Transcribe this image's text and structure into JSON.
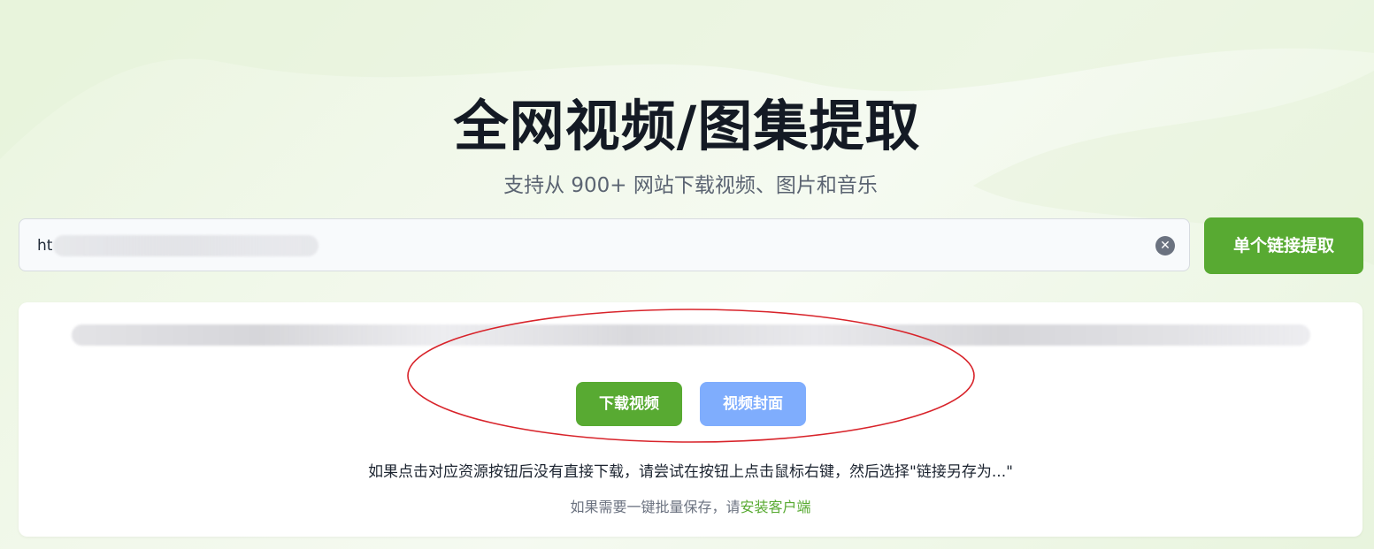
{
  "header": {
    "title": "全网视频/图集提取",
    "subtitle": "支持从 900+ 网站下载视频、图片和音乐"
  },
  "search": {
    "value_prefix": "ht",
    "clear_icon": "clear-icon",
    "submit_label": "单个链接提取"
  },
  "result": {
    "buttons": {
      "download_video": "下载视频",
      "video_cover": "视频封面"
    },
    "hint": "如果点击对应资源按钮后没有直接下载，请尝试在按钮上点击鼠标右键，然后选择\"链接另存为...\"",
    "batch_prefix": "如果需要一键批量保存，请",
    "batch_link": "安装客户端"
  },
  "colors": {
    "primary_green": "#58aa32",
    "cover_blue": "#7fadfd",
    "annotation_red": "#d8232a"
  }
}
